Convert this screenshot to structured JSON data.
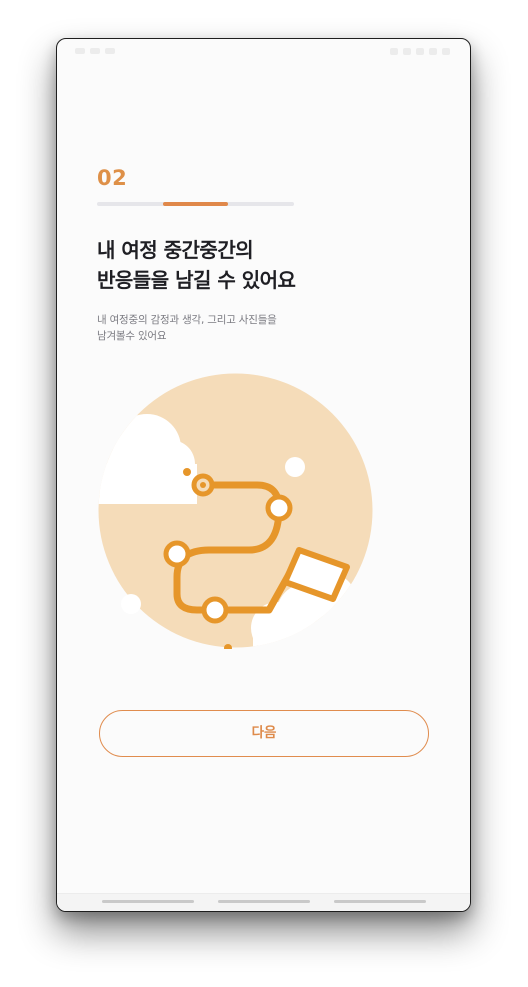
{
  "onboarding": {
    "step_number": "02",
    "step_progress": {
      "segment_index": 2,
      "total_segments": 3
    },
    "title_line1": "내 여정 중간중간의",
    "title_line2": "반응들을 남길 수 있어요",
    "description_line1": "내 여정중의 감정과 생각, 그리고 사진들을",
    "description_line2": "남겨볼수 있어요",
    "illustration_icon": "journey-route-flag-icon",
    "next_button_label": "다음"
  },
  "colors": {
    "accent": "#e0884a",
    "illustration_bg": "#f5dcb9",
    "route": "#e6962a",
    "title_text": "#1f1f24",
    "subtitle_text": "#7b7b82",
    "progress_track": "#e6e6ea"
  }
}
